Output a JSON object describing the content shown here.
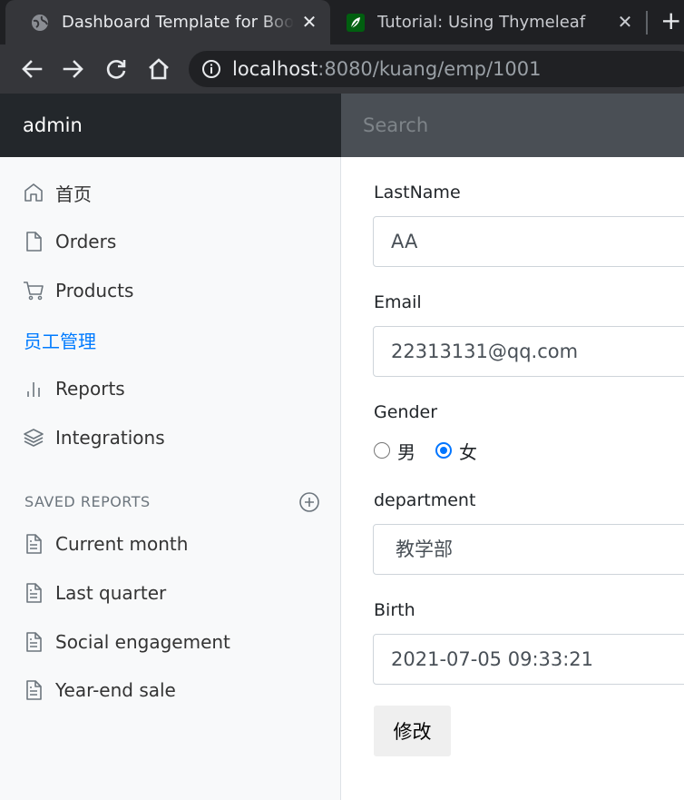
{
  "browser": {
    "tabs": [
      {
        "title": "Dashboard Template for Bootstrap",
        "active": true
      },
      {
        "title": "Tutorial: Using Thymeleaf",
        "active": false
      }
    ],
    "url_host": "localhost",
    "url_path": ":8080/kuang/emp/1001"
  },
  "navbar": {
    "brand": "admin",
    "search_placeholder": "Search"
  },
  "sidebar": {
    "items": [
      {
        "label": "首页",
        "icon": "home-icon"
      },
      {
        "label": "Orders",
        "icon": "file-icon"
      },
      {
        "label": "Products",
        "icon": "shopping-cart-icon"
      },
      {
        "label": "员工管理",
        "icon": "",
        "active": true
      },
      {
        "label": "Reports",
        "icon": "bar-chart-icon"
      },
      {
        "label": "Integrations",
        "icon": "layers-icon"
      }
    ],
    "saved_reports_header": "SAVED REPORTS",
    "saved_reports": [
      {
        "label": "Current month",
        "icon": "file-text-icon"
      },
      {
        "label": "Last quarter",
        "icon": "file-text-icon"
      },
      {
        "label": "Social engagement",
        "icon": "file-text-icon"
      },
      {
        "label": "Year-end sale",
        "icon": "file-text-icon"
      }
    ]
  },
  "form": {
    "lastname_label": "LastName",
    "lastname_value": "AA",
    "email_label": "Email",
    "email_value": "22313131@qq.com",
    "gender_label": "Gender",
    "gender_options": [
      "男",
      "女"
    ],
    "gender_selected": "女",
    "department_label": "department",
    "department_value": "教学部",
    "birth_label": "Birth",
    "birth_value": "2021-07-05 09:33:21",
    "submit_label": "修改"
  },
  "colors": {
    "accent": "#007bff",
    "navbar_bg": "#343a40",
    "brand_bg": "#23272b",
    "sidebar_bg": "#f8f9fa"
  }
}
